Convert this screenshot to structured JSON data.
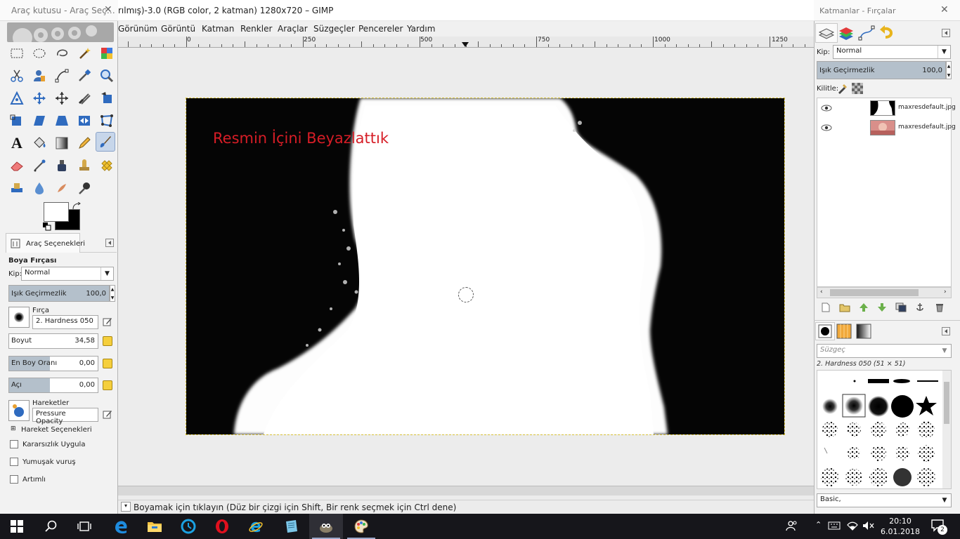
{
  "main_window": {
    "title": "rılmış)-3.0 (RGB color, 2 katman) 1280x720 – GIMP",
    "menu": [
      "Görünüm",
      "Görüntü",
      "Katman",
      "Renkler",
      "Araçlar",
      "Süzgeçler",
      "Pencereler",
      "Yardım"
    ],
    "ruler_labels": [
      "0",
      "250",
      "500",
      "750",
      "1000",
      "1250"
    ],
    "canvas_text": "Resmin İçini Beyazlattık",
    "status_text": "Boyamak için tıklayın (Düz bir çizgi için Shift, Bir renk seçmek için Ctrl dene)"
  },
  "toolbox": {
    "title": "Araç kutusu - Araç Seç…",
    "tools": [
      "rect-select",
      "ellipse-select",
      "free-select",
      "fuzzy-select",
      "color-select",
      "scissors",
      "foreground-select",
      "paths",
      "color-picker",
      "zoom",
      "measure",
      "move",
      "align",
      "crop",
      "transform",
      "perspective",
      "flip",
      "cage",
      "unified-transform",
      "text",
      "bucket-fill",
      "blend",
      "pencil",
      "paintbrush",
      "eraser",
      "airbrush",
      "ink",
      "clone",
      "heal",
      "perspective-clone",
      "blur",
      "smudge",
      "dodge-burn"
    ],
    "active_tool": "paintbrush",
    "options_tab": "Araç Seçenekleri",
    "options": {
      "tool_name": "Boya Fırçası",
      "mode_label": "Kip:",
      "mode_value": "Normal",
      "opacity_label": "Işık Geçirmezlik",
      "opacity_value": "100,0",
      "brush_label": "Fırça",
      "brush_value": "2. Hardness 050",
      "size_label": "Boyut",
      "size_value": "34,58",
      "aspect_label": "En Boy Oranı",
      "aspect_value": "0,00",
      "angle_label": "Açı",
      "angle_value": "0,00",
      "dynamics_label": "Hareketler",
      "dynamics_value": "Pressure Opacity",
      "dynamics_options": "Hareket Seçenekleri",
      "jitter_label": "Kararsızlık Uygula",
      "smooth_label": "Yumuşak vuruş",
      "incremental_label": "Artımlı"
    }
  },
  "dock": {
    "title": "Katmanlar - Fırçalar",
    "mode_label": "Kip:",
    "mode_value": "Normal",
    "opacity_label": "Işık Geçirmezlik",
    "opacity_value": "100,0",
    "lock_label": "Kilitle:",
    "layers": [
      {
        "name": "maxresdefault.jpg",
        "visible": true,
        "thumb": "mask"
      },
      {
        "name": "maxresdefault.jpg",
        "visible": true,
        "thumb": "photo"
      }
    ],
    "filter_placeholder": "Süzgeç",
    "brush_name": "2. Hardness 050 (51 × 51)",
    "brush_tag": "Basic,"
  },
  "taskbar": {
    "time": "20:10",
    "date": "6.01.2018",
    "notifications": "2",
    "apps": [
      "start",
      "search",
      "task-view",
      "edge",
      "file-explorer",
      "opera-gx",
      "opera",
      "internet-explorer",
      "notepad",
      "gimp",
      "paint"
    ]
  }
}
